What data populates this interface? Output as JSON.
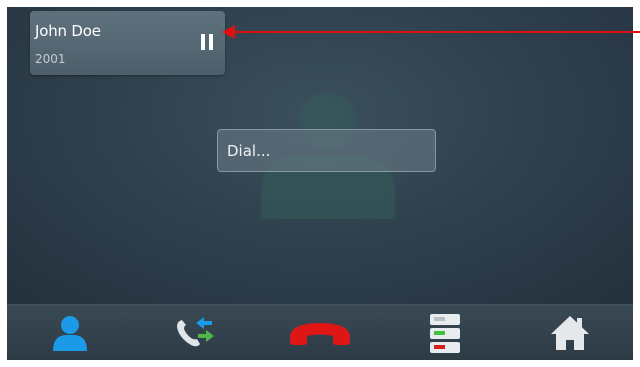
{
  "active_call": {
    "name": "John Doe",
    "number": "2001"
  },
  "dial": {
    "placeholder": "Dial..."
  },
  "icons": {
    "hold": "pause-icon",
    "contacts": "person-icon",
    "transfer": "call-transfer-icon",
    "hangup": "hang-up-icon",
    "lines": "line-status-icon",
    "home": "home-icon"
  },
  "colors": {
    "annotation": "#e01010",
    "contacts": "#1a9ae8",
    "hangup": "#e01515",
    "line_green": "#3ec43e",
    "line_red": "#d42020"
  }
}
